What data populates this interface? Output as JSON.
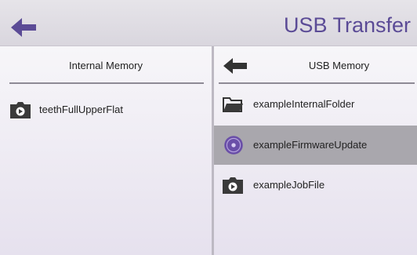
{
  "header": {
    "title": "USB Transfer"
  },
  "internal": {
    "title": "Internal Memory",
    "files": [
      {
        "name": "teethFullUpperFlat",
        "icon": "video-folder-icon"
      }
    ]
  },
  "usb": {
    "title": "USB Memory",
    "files": [
      {
        "name": "exampleInternalFolder",
        "icon": "folder-icon",
        "selected": false
      },
      {
        "name": "exampleFirmwareUpdate",
        "icon": "firmware-disc-icon",
        "selected": true
      },
      {
        "name": "exampleJobFile",
        "icon": "video-folder-icon",
        "selected": false
      }
    ]
  },
  "colors": {
    "accent": "#5b4b96",
    "selected_row": "#a9a7ad"
  }
}
